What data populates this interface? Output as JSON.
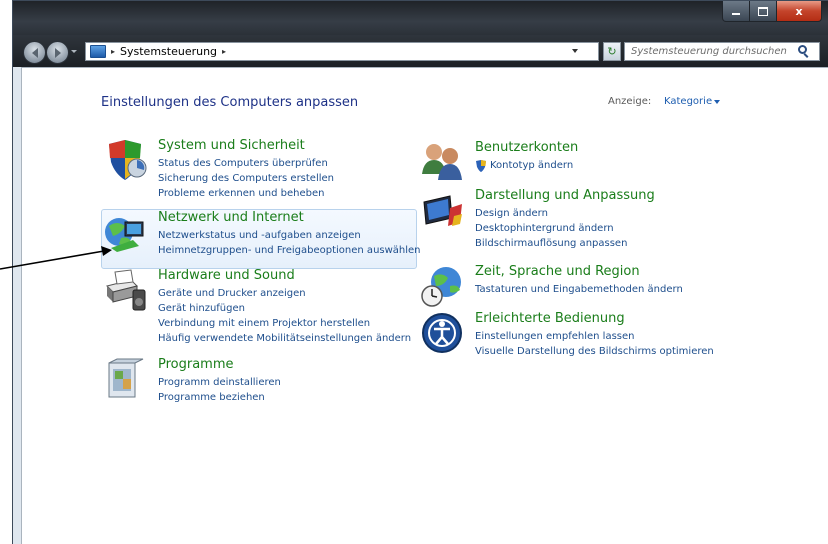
{
  "window": {
    "close_glyph": "x"
  },
  "address": {
    "breadcrumb": "Systemsteuerung",
    "separator": "▸"
  },
  "search": {
    "placeholder": "Systemsteuerung durchsuchen"
  },
  "main": {
    "heading": "Einstellungen des Computers anpassen",
    "view_label": "Anzeige:",
    "view_value": "Kategorie"
  },
  "categories": [
    {
      "title": "System und Sicherheit",
      "icon": "shield-icon",
      "links": [
        "Status des Computers überprüfen",
        "Sicherung des Computers erstellen",
        "Probleme erkennen und beheben"
      ]
    },
    {
      "title": "Netzwerk und Internet",
      "icon": "network-globe-icon",
      "links": [
        "Netzwerkstatus und -aufgaben anzeigen",
        "Heimnetzgruppen- und Freigabeoptionen auswählen"
      ]
    },
    {
      "title": "Hardware und Sound",
      "icon": "printer-speaker-icon",
      "links": [
        "Geräte und Drucker anzeigen",
        "Gerät hinzufügen",
        "Verbindung mit einem Projektor herstellen",
        "Häufig verwendete Mobilitätseinstellungen ändern"
      ]
    },
    {
      "title": "Programme",
      "icon": "programs-icon",
      "links": [
        "Programm deinstallieren",
        "Programme beziehen"
      ]
    },
    {
      "title": "Benutzerkonten",
      "icon": "users-icon",
      "links": [
        "Kontotyp ändern"
      ]
    },
    {
      "title": "Darstellung und Anpassung",
      "icon": "display-icon",
      "links": [
        "Design ändern",
        "Desktophintergrund ändern",
        "Bildschirmauflösung anpassen"
      ]
    },
    {
      "title": "Zeit, Sprache und Region",
      "icon": "globe-clock-icon",
      "links": [
        "Tastaturen und Eingabemethoden ändern"
      ]
    },
    {
      "title": "Erleichterte Bedienung",
      "icon": "accessibility-icon",
      "links": [
        "Einstellungen empfehlen lassen",
        "Visuelle Darstellung des Bildschirms optimieren"
      ]
    }
  ],
  "colors": {
    "title_green": "#1a7d1a",
    "link_blue": "#1e4e8c",
    "heading_blue": "#1e3287"
  }
}
